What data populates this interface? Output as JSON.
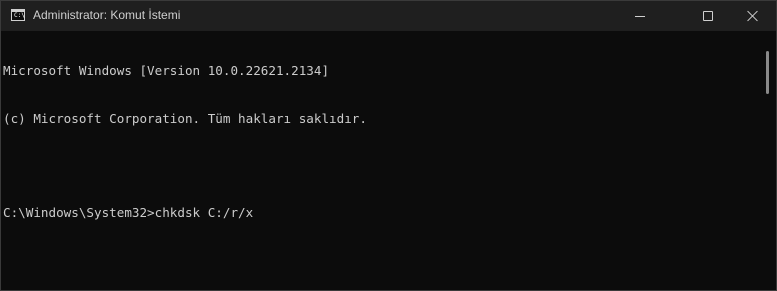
{
  "window": {
    "title": "Administrator: Komut İstemi",
    "icon": "cmd-icon",
    "icon_prompt": "C:\\",
    "controls": [
      "minimize-icon",
      "maximize-icon",
      "close-icon"
    ]
  },
  "console": {
    "lines": [
      "Microsoft Windows [Version 10.0.22621.2134]",
      "(c) Microsoft Corporation. Tüm hakları saklıdır.",
      "",
      "C:\\Windows\\System32>chkdsk C:/r/x"
    ]
  },
  "colors": {
    "background": "#0c0c0c",
    "titlebar": "#1f1f1f",
    "text": "#cccccc"
  }
}
